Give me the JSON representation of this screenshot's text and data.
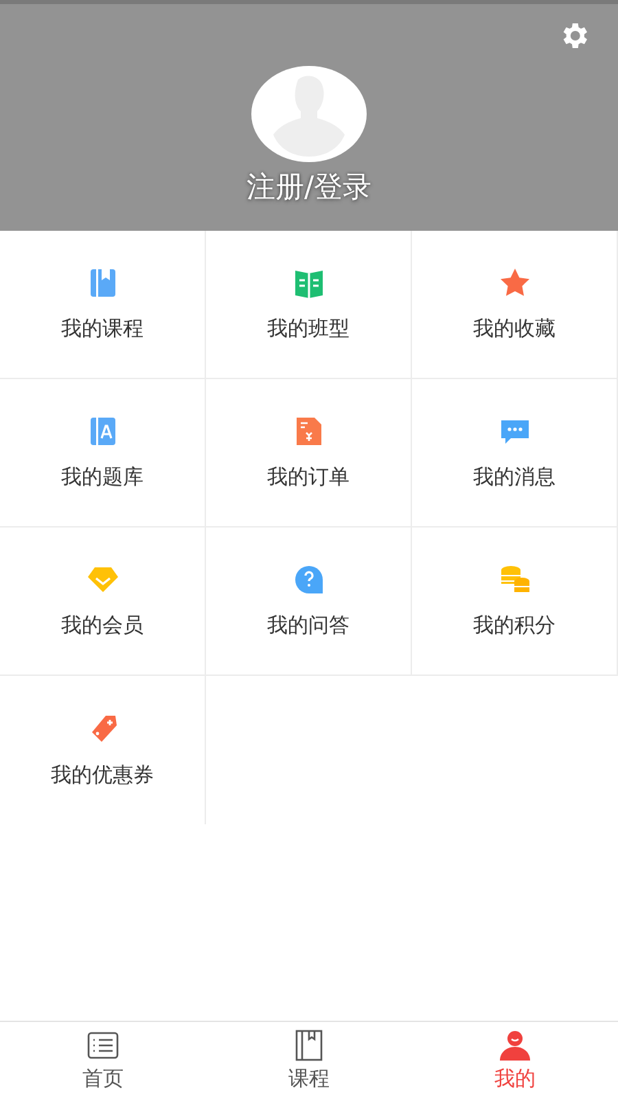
{
  "header": {
    "login_text": "注册/登录"
  },
  "menu": [
    {
      "kind": "course",
      "label": "我的课程"
    },
    {
      "kind": "class",
      "label": "我的班型"
    },
    {
      "kind": "favorite",
      "label": "我的收藏"
    },
    {
      "kind": "bank",
      "label": "我的题库"
    },
    {
      "kind": "order",
      "label": "我的订单"
    },
    {
      "kind": "message",
      "label": "我的消息"
    },
    {
      "kind": "member",
      "label": "我的会员"
    },
    {
      "kind": "qa",
      "label": "我的问答"
    },
    {
      "kind": "points",
      "label": "我的积分"
    },
    {
      "kind": "coupon",
      "label": "我的优惠券"
    }
  ],
  "tab_bar": [
    {
      "kind": "home",
      "label": "首页",
      "selected": false
    },
    {
      "kind": "course",
      "label": "课程",
      "selected": false
    },
    {
      "kind": "me",
      "label": "我的",
      "selected": true
    }
  ]
}
